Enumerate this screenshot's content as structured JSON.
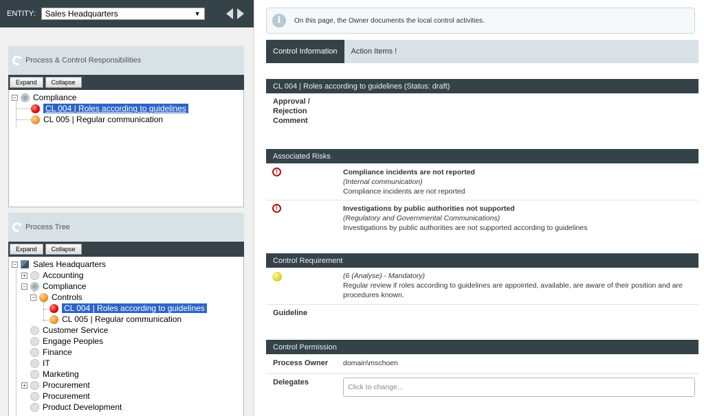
{
  "entity": {
    "label": "ENTITY:",
    "selected": "Sales Headquarters"
  },
  "responsibilities": {
    "title": "Process & Control Responsibilities",
    "expand_label": "Expand",
    "collapse_label": "Collapse",
    "root": "Compliance",
    "items": [
      "CL 004 | Roles according to guidelines",
      "CL 005 | Regular communication"
    ]
  },
  "process_tree": {
    "title": "Process Tree",
    "expand_label": "Expand",
    "collapse_label": "Collapse",
    "root": "Sales Headquarters",
    "nodes": [
      "Accounting",
      "Compliance",
      "Controls",
      "CL 004 | Roles according to guidelines",
      "CL 005 | Regular communication",
      "Customer Service",
      "Engage Peoples",
      "Finance",
      "IT",
      "Marketing",
      "Procurement",
      "Procurement",
      "Product Development"
    ]
  },
  "info": {
    "text": "On this page, the Owner documents the local control activities."
  },
  "tabs": [
    "Control Information",
    "Action Items !"
  ],
  "control_header": {
    "title": "CL 004 | Roles according to guidelines (Status: draft)"
  },
  "approval": {
    "label_line1": "Approval /",
    "label_line2": "Rejection",
    "label_line3": "Comment"
  },
  "risks": {
    "title": "Associated Risks",
    "items": [
      {
        "title": "Compliance incidents are not reported",
        "category": "(Internal communication)",
        "description": "Compliance incidents are not reported"
      },
      {
        "title": "Investigations by public authorities not supported",
        "category": "(Regulatory and Governmental Communications)",
        "description": "Investigations by public authorities are not supported according to guidelines"
      }
    ]
  },
  "requirement": {
    "title": "Control Requirement",
    "level": "(6 (Analyse) - Mandatory)",
    "description_line1": "Regular review if roles according to guidelines are appointed, available, are aware of their position and are",
    "description_line2": "procedures known.",
    "guideline_label": "Guideline"
  },
  "permission": {
    "title": "Control Permission",
    "owner_label": "Process Owner",
    "owner_value": "domain\\mschoen",
    "delegates_label": "Delegates",
    "delegates_placeholder": "Click to change..."
  },
  "colors": {
    "dark_bar": "#354349",
    "panel_head": "#d8e2e6",
    "selection": "#2d64c8",
    "risk_red": "#b01313"
  }
}
